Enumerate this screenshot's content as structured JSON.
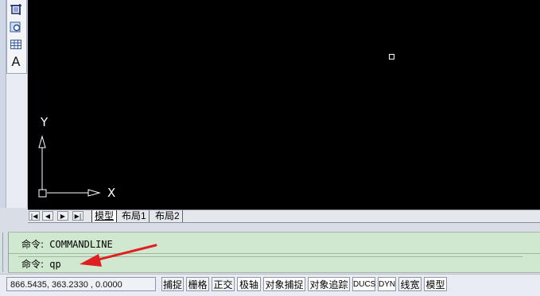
{
  "toolbar": {
    "icons": [
      "region-crop-icon",
      "magnify-icon",
      "table-icon",
      "text-icon"
    ],
    "text_tool_label": "A"
  },
  "drawing": {
    "background": "#000000",
    "ucs_x_label": "X",
    "ucs_y_label": "Y"
  },
  "tab_bar": {
    "nav_buttons": [
      "|◀",
      "◀",
      "▶",
      "▶|"
    ],
    "tabs": [
      "模型",
      "布局1",
      "布局2"
    ],
    "active_tab": "模型"
  },
  "command_window": {
    "line1_prefix": "命令:",
    "line1_text": "COMMANDLINE",
    "line2_prefix": "命令:",
    "line2_text": "qp",
    "background": "#cfe8cf"
  },
  "annotation": {
    "arrow_color": "#e02020"
  },
  "status_bar": {
    "coordinates": "866.5435,  363.2330 , 0.0000",
    "buttons": [
      "捕捉",
      "栅格",
      "正交",
      "极轴",
      "对象捕捉",
      "对象追踪",
      "DUCS",
      "DYN",
      "线宽",
      "模型"
    ]
  }
}
